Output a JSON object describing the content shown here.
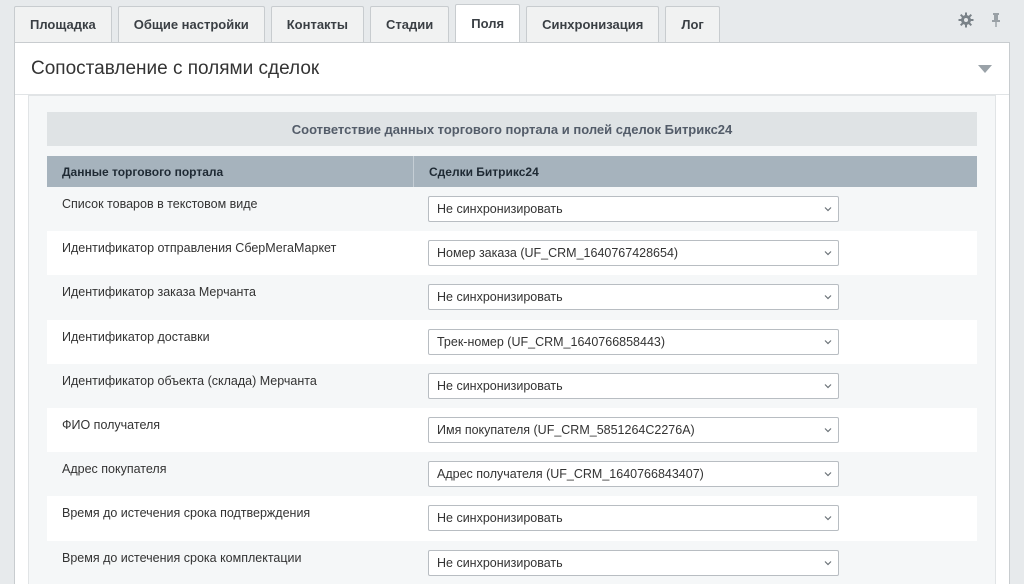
{
  "tabs": [
    {
      "label": "Площадка",
      "active": false
    },
    {
      "label": "Общие настройки",
      "active": false
    },
    {
      "label": "Контакты",
      "active": false
    },
    {
      "label": "Стадии",
      "active": false
    },
    {
      "label": "Поля",
      "active": true
    },
    {
      "label": "Синхронизация",
      "active": false
    },
    {
      "label": "Лог",
      "active": false
    }
  ],
  "tools": {
    "settings_icon": "gear-icon",
    "pin_icon": "pin-icon"
  },
  "panel": {
    "title": "Сопоставление с полями сделок",
    "section_title": "Соответствие данных торгового портала и полей сделок Битрикс24",
    "columns": {
      "left": "Данные торгового портала",
      "right": "Сделки Битрикс24"
    },
    "rows": [
      {
        "label": "Список товаров в текстовом виде",
        "value": "Не синхронизировать"
      },
      {
        "label": "Идентификатор отправления СберМегаМаркет",
        "value": "Номер заказа (UF_CRM_1640767428654)"
      },
      {
        "label": "Идентификатор заказа Мерчанта",
        "value": "Не синхронизировать"
      },
      {
        "label": "Идентификатор доставки",
        "value": "Трек-номер (UF_CRM_1640766858443)"
      },
      {
        "label": "Идентификатор объекта (склада) Мерчанта",
        "value": "Не синхронизировать"
      },
      {
        "label": "ФИО получателя",
        "value": "Имя покупателя (UF_CRM_5851264C2276A)"
      },
      {
        "label": "Адрес покупателя",
        "value": "Адрес получателя (UF_CRM_1640766843407)"
      },
      {
        "label": "Время до истечения срока подтверждения",
        "value": "Не синхронизировать"
      },
      {
        "label": "Время до истечения срока комплектации",
        "value": "Не синхронизировать"
      }
    ]
  },
  "colors": {
    "accent_header": "#a6b3bd",
    "section_bg": "#dfe3e5",
    "page_bg": "#e7eaec"
  }
}
